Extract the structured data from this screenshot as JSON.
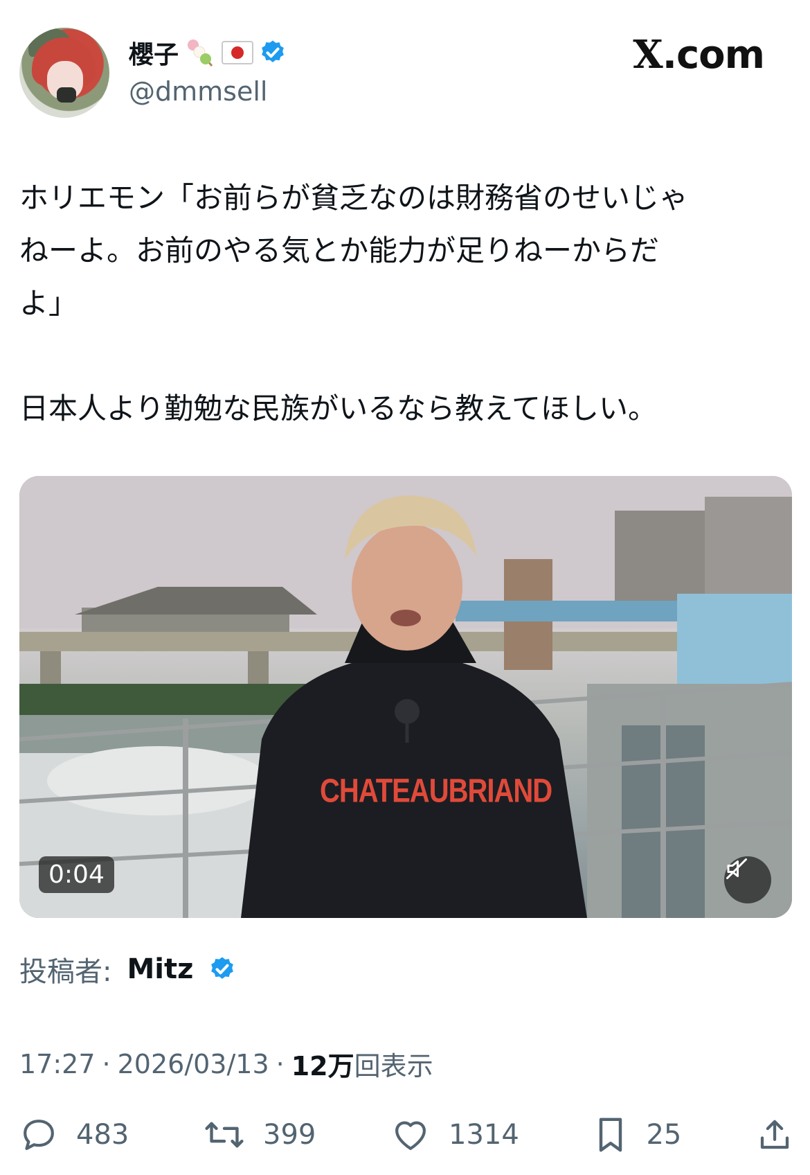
{
  "header": {
    "display_name": "櫻子",
    "handle": "@dmmsell",
    "site": ".com",
    "site_mark": "X",
    "icons": [
      "dango-emoji",
      "japan-flag-emoji",
      "verified-badge-icon"
    ]
  },
  "tweet": {
    "text": "ホリエモン「お前らが貧乏なのは財務省のせいじゃ\nねーよ。お前のやる気とか能力が足りねーからだ\nよ」\n\n日本人より勤勉な民族がいるなら教えてほしい。"
  },
  "media": {
    "type": "video",
    "duration": "0:04",
    "shirt_text": "CHATEAUBRIAND",
    "mute_icon": "speaker-muted-icon"
  },
  "attribution": {
    "label": "投稿者:",
    "name": "Mitz"
  },
  "meta": {
    "time": "17:27",
    "sep": "·",
    "date": "2026/03/13",
    "views_count": "12万",
    "views_label": "回表示"
  },
  "actions": {
    "replies": "483",
    "reposts": "399",
    "likes": "1314",
    "bookmarks": "25"
  },
  "colors": {
    "verified": "#1d9bf0",
    "secondary_text": "#536471",
    "primary_text": "#0f1419"
  }
}
